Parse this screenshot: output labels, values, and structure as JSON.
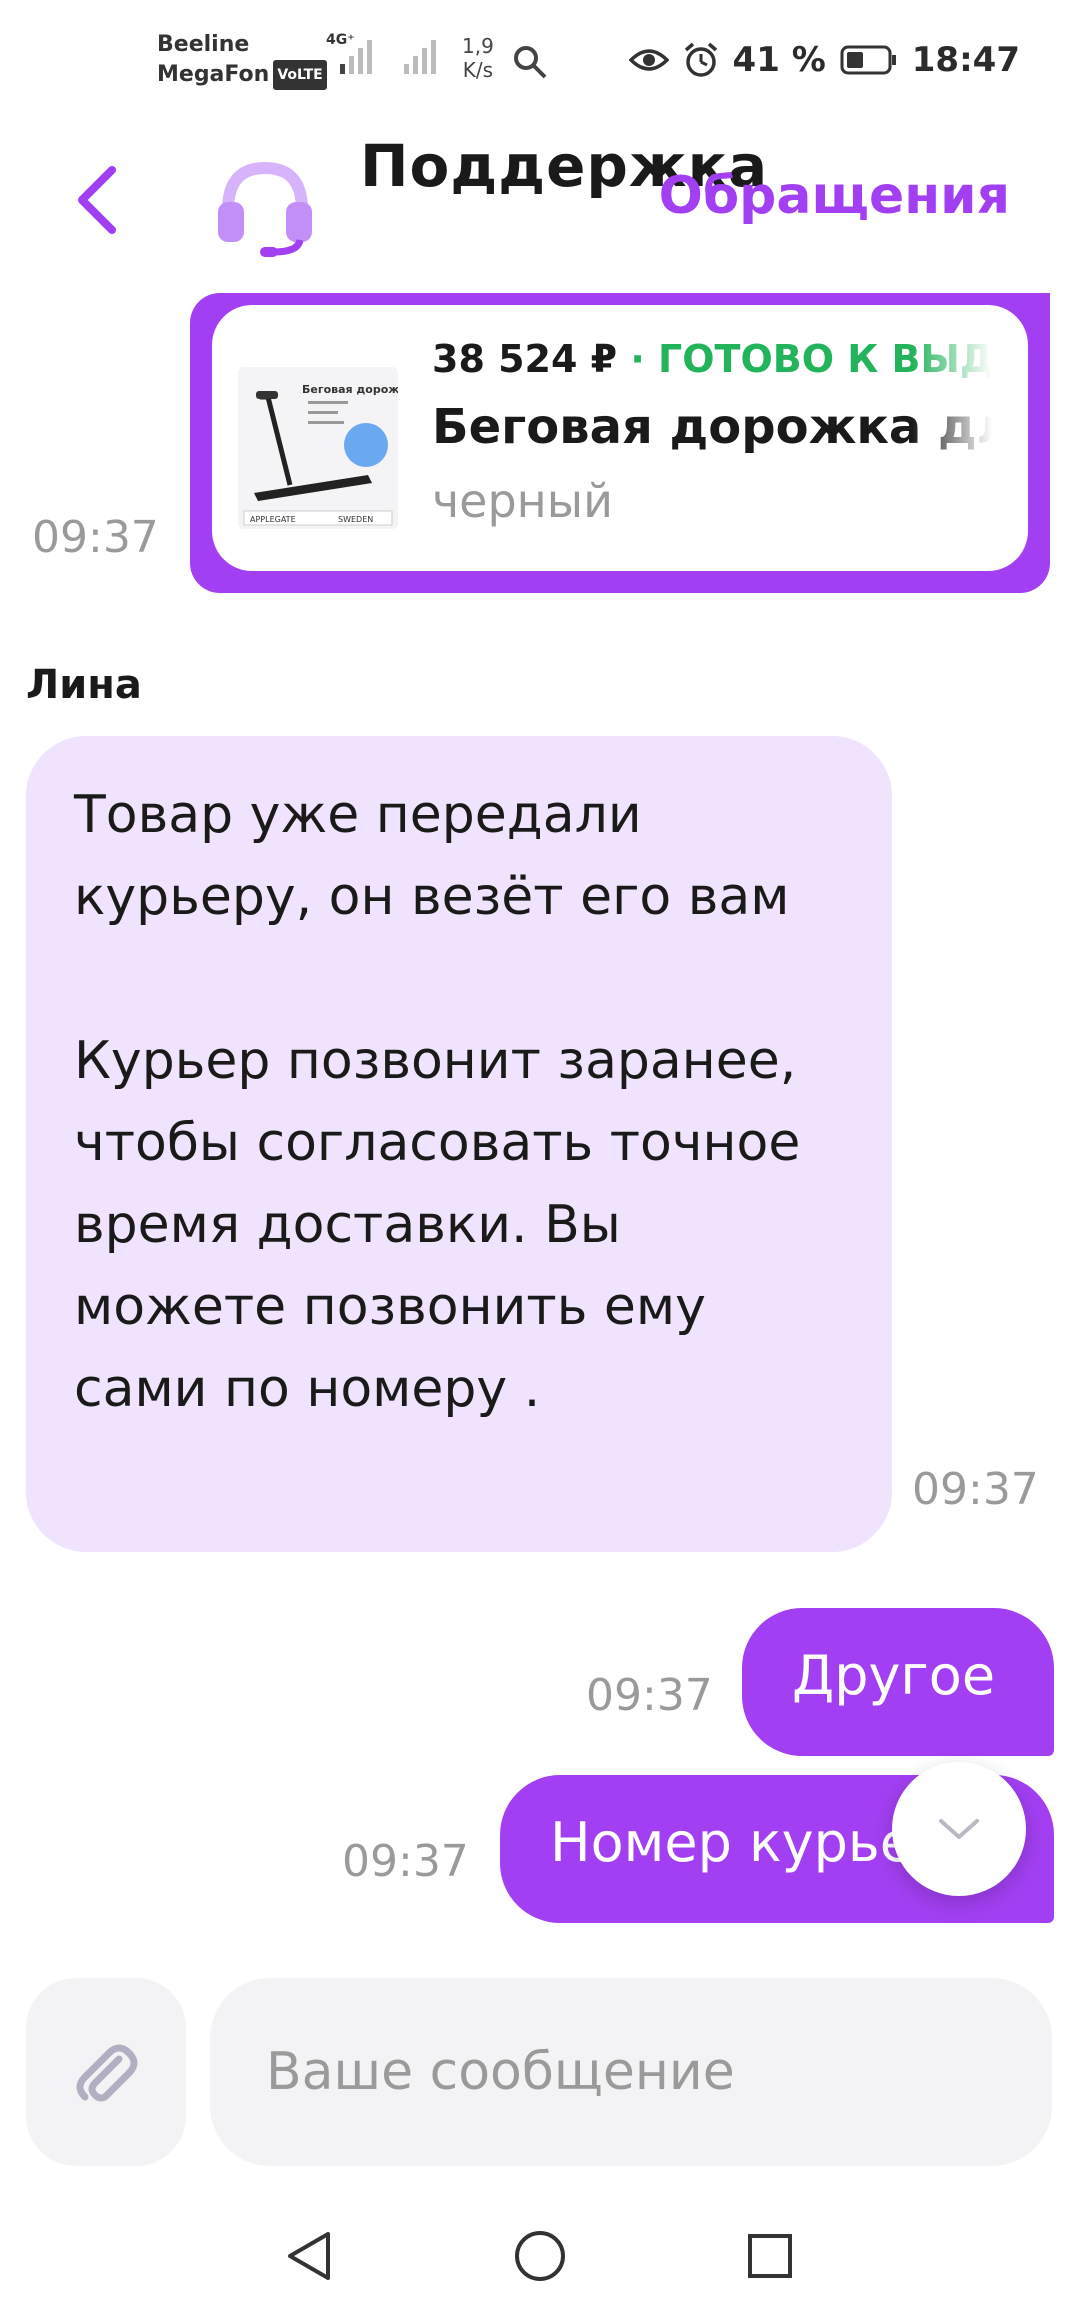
{
  "status_bar": {
    "operator1": "Beeline",
    "operator2": "MegaFon",
    "volte": "VoLTE",
    "network": "4G⁺",
    "speed_value": "1,9",
    "speed_unit": "K/s",
    "battery": "41 %",
    "time": "18:47"
  },
  "header": {
    "title": "Поддержка",
    "tickets_link": "Обращения",
    "accent_color": "#a23ff2"
  },
  "product_message": {
    "time": "09:37",
    "price": "38 524 ₽",
    "separator": " · ",
    "status": "ГОТОВО К ВЫДАЧЕ",
    "name": "Беговая дорожка для дома",
    "color": "черный",
    "status_color": "#22b35b",
    "image_text": {
      "title": "Беговая дорожка",
      "brand": "APPLEGATE",
      "country": "SWEDEN"
    }
  },
  "agent_message": {
    "name": "Лина",
    "text": "Товар уже передали курьеру, он везёт его вам\n\nКурьер позвонит заранее, чтобы согласовать точное время доставки. Вы можете позвонить ему сами по номеру .",
    "time": "09:37"
  },
  "user_messages": [
    {
      "text": "Другое",
      "time": "09:37"
    },
    {
      "text": "Номер курьера",
      "time": "09:37"
    }
  ],
  "composer": {
    "placeholder": "Ваше сообщение",
    "value": ""
  },
  "icons": {
    "back": "chevron-left-icon",
    "support": "headset-icon",
    "attach": "paperclip-icon",
    "scroll": "chevron-down-icon"
  }
}
